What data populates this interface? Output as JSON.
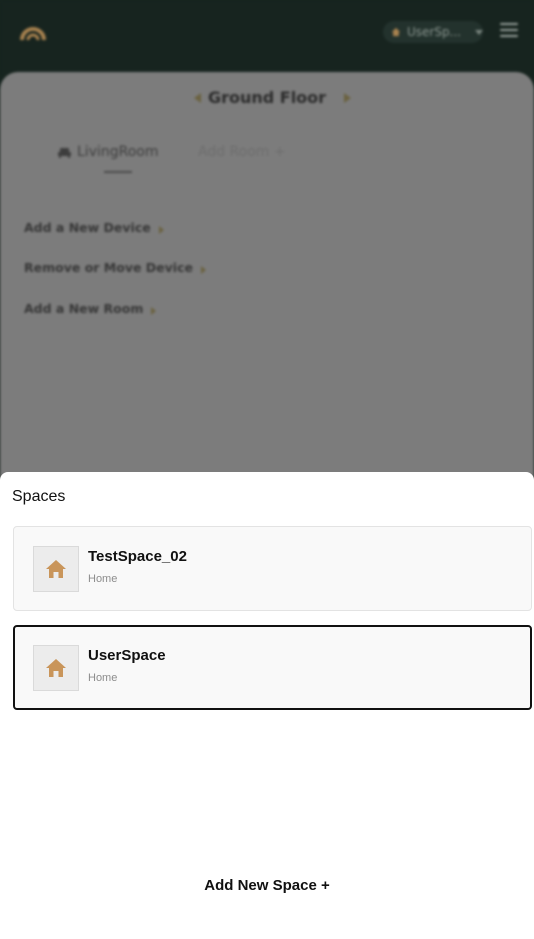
{
  "colors": {
    "accent_gold": "#c9955a",
    "topbar_bg": "#17241f",
    "selected_border": "#111111"
  },
  "header": {
    "logo_icon": "arc-logo-icon",
    "space_selector_label": "UserSp...",
    "menu_icon": "hamburger-menu-icon"
  },
  "floor": {
    "title": "Ground Floor"
  },
  "rooms": {
    "tabs": [
      {
        "label": "LivingRoom",
        "icon": "sofa-icon",
        "active": true
      },
      {
        "label": "Add Room +",
        "active": false
      }
    ]
  },
  "actions": [
    {
      "label": "Add a New Device"
    },
    {
      "label": "Remove or Move Device"
    },
    {
      "label": "Add a New Room"
    }
  ],
  "sheet": {
    "title": "Spaces",
    "spaces": [
      {
        "name": "TestSpace_02",
        "type": "Home",
        "icon": "home-icon",
        "selected": false
      },
      {
        "name": "UserSpace",
        "type": "Home",
        "icon": "home-icon",
        "selected": true
      }
    ],
    "add_label": "Add New Space +"
  }
}
